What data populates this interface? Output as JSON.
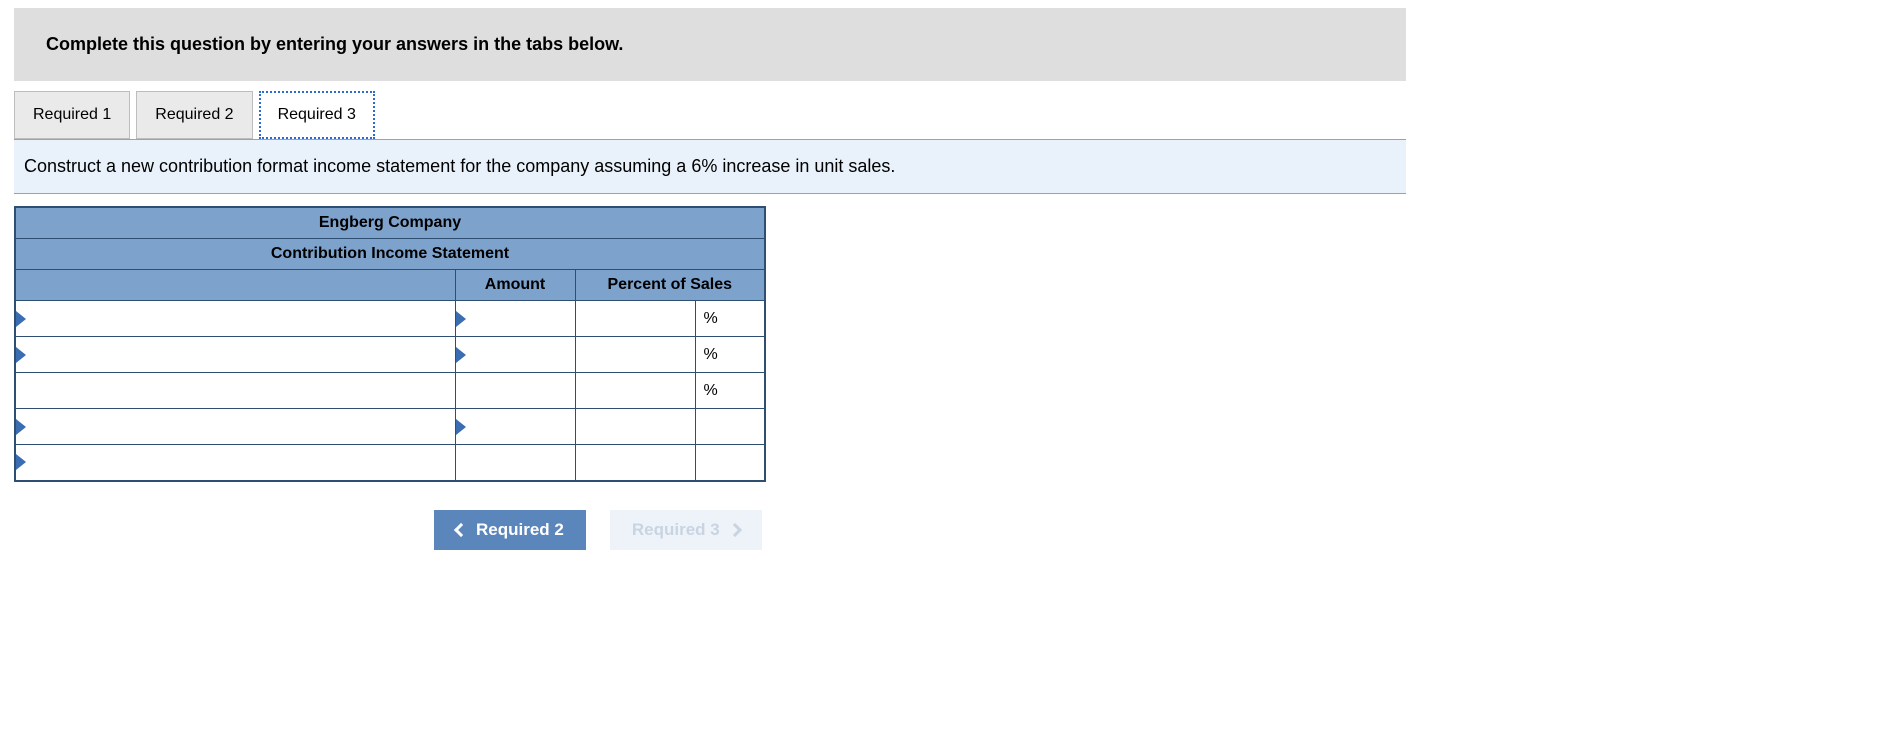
{
  "instruction": "Complete this question by entering your answers in the tabs below.",
  "tabs": [
    {
      "label": "Required 1",
      "active": false
    },
    {
      "label": "Required 2",
      "active": false
    },
    {
      "label": "Required 3",
      "active": true
    }
  ],
  "question": "Construct a new contribution format income statement for the company assuming a 6% increase in unit sales.",
  "table": {
    "title1": "Engberg Company",
    "title2": "Contribution Income Statement",
    "col_amount": "Amount",
    "col_percent": "Percent of Sales",
    "rows": [
      {
        "label": "",
        "amount": "",
        "percent": "",
        "sym": "%",
        "label_tri": true,
        "amount_tri": true
      },
      {
        "label": "",
        "amount": "",
        "percent": "",
        "sym": "%",
        "label_tri": true,
        "amount_tri": true
      },
      {
        "label": "",
        "amount": "",
        "percent": "",
        "sym": "%",
        "label_tri": false,
        "amount_tri": false
      },
      {
        "label": "",
        "amount": "",
        "percent": "",
        "sym": "",
        "label_tri": true,
        "amount_tri": true
      },
      {
        "label": "",
        "amount": "",
        "percent": "",
        "sym": "",
        "label_tri": true,
        "amount_tri": false
      }
    ]
  },
  "nav": {
    "prev": "Required 2",
    "next": "Required 3"
  }
}
